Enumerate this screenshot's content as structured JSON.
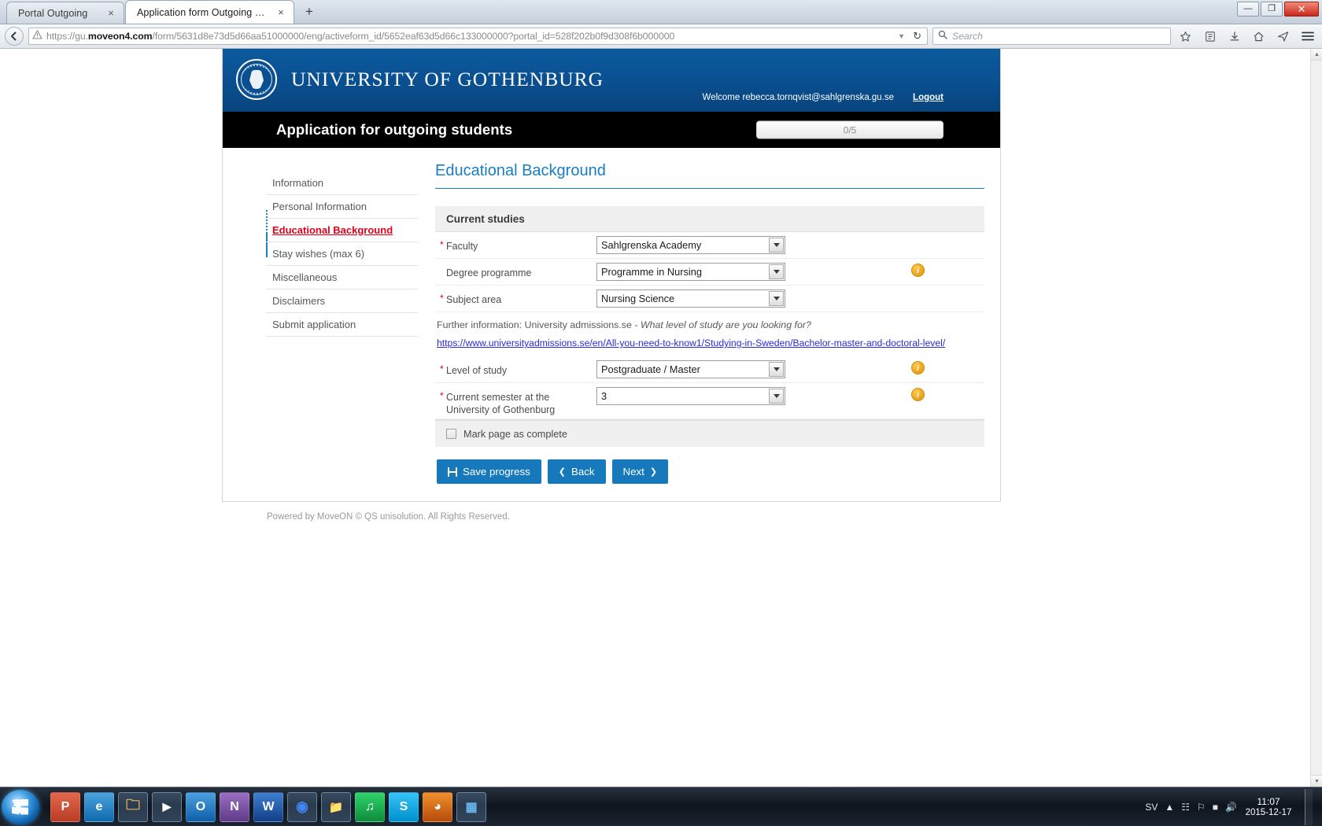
{
  "browser": {
    "tabs": [
      {
        "title": "Portal Outgoing",
        "active": false,
        "close": "×"
      },
      {
        "title": "Application form Outgoing Stu...",
        "active": true,
        "close": "×"
      }
    ],
    "newtab_label": "+",
    "window_controls": {
      "minimize": "—",
      "maximize": "❐",
      "close": "✕"
    },
    "url": {
      "scheme": "https://gu.",
      "domain": "moveon4.com",
      "path": "/form/5631d8e73d5d66aa51000000/eng/activeform_id/5652eaf63d5d66c133000000?portal_id=528f202b0f9d308f6b000000",
      "full": "https://gu.moveon4.com/form/5631d8e73d5d66aa51000000/eng/activeform_id/5652eaf63d5d66c133000000?portal_id=528f202b0f9d308f6b000000",
      "warning_icon": "warning-triangle-icon",
      "dropdown_icon": "chevron-down-icon",
      "reload_icon": "reload-icon"
    },
    "search": {
      "placeholder": "Search",
      "icon": "search-icon"
    },
    "toolbar_icons": [
      "bookmark-star-icon",
      "reading-list-icon",
      "downloads-icon",
      "home-icon",
      "share-icon",
      "menu-hamburger-icon"
    ],
    "back_icon": "back-arrow-icon"
  },
  "site": {
    "university_name": "UNIVERSITY OF GOTHENBURG",
    "logo_name": "university-of-gothenburg-seal",
    "welcome_text": "Welcome rebecca.tornqvist@sahlgrenska.gu.se",
    "logout_label": "Logout",
    "app_title": "Application for outgoing students",
    "progress_text": "0/5",
    "footer": "Powered by MoveON © QS unisolution. All Rights Reserved."
  },
  "sidebar": {
    "items": [
      {
        "label": "Information",
        "active": false
      },
      {
        "label": "Personal Information",
        "active": false
      },
      {
        "label": "Educational Background",
        "active": true
      },
      {
        "label": "Stay wishes (max 6)",
        "active": false
      },
      {
        "label": "Miscellaneous",
        "active": false
      },
      {
        "label": "Disclaimers",
        "active": false
      },
      {
        "label": "Submit application",
        "active": false
      }
    ]
  },
  "form": {
    "title": "Educational Background",
    "section_title": "Current studies",
    "rows": [
      {
        "label": "Faculty",
        "required": true,
        "value": "Sahlgrenska Academy",
        "info": false
      },
      {
        "label": "Degree programme",
        "required": false,
        "value": "Programme in Nursing",
        "info": true
      },
      {
        "label": "Subject area",
        "required": true,
        "value": "Nursing Science",
        "info": false
      }
    ],
    "help_prefix": "Further information: University admissions.se - ",
    "help_italic": "What level of study are you looking for?",
    "external_link": "https://www.universityadmissions.se/en/All-you-need-to-know1/Studying-in-Sweden/Bachelor-master-and-doctoral-level/",
    "rows2": [
      {
        "label": "Level of study",
        "required": true,
        "value": "Postgraduate / Master",
        "info": true
      },
      {
        "label": "Current semester at the University of Gothenburg",
        "required": true,
        "value": "3",
        "info": true
      }
    ],
    "mark_complete_label": "Mark page as complete",
    "info_badge_char": "i",
    "buttons": {
      "save": "Save progress",
      "back": "Back",
      "next": "Next",
      "back_arrow": "❮",
      "next_arrow": "❯"
    }
  },
  "taskbar": {
    "start_label": "start-orb",
    "apps": [
      {
        "name": "powerpoint",
        "glyph": "P",
        "color": "#c6472f"
      },
      {
        "name": "internet-explorer",
        "glyph": "e",
        "color": "#1b7fc4"
      },
      {
        "name": "windows-explorer",
        "glyph": "🗀",
        "color": "#e0a93a"
      },
      {
        "name": "media-player",
        "glyph": "▶",
        "color": "#2f6fb0"
      },
      {
        "name": "outlook",
        "glyph": "O",
        "color": "#1b6ec2"
      },
      {
        "name": "onenote",
        "glyph": "N",
        "color": "#7a4ea6"
      },
      {
        "name": "word",
        "glyph": "W",
        "color": "#1b4f9c"
      },
      {
        "name": "chrome",
        "glyph": "◉",
        "color": "#4285f4"
      },
      {
        "name": "folder",
        "glyph": "📁",
        "color": "#e6b24a"
      },
      {
        "name": "spotify",
        "glyph": "♫",
        "color": "#1db954"
      },
      {
        "name": "skype",
        "glyph": "S",
        "color": "#00aff0"
      },
      {
        "name": "firefox",
        "glyph": "◕",
        "color": "#e06a1a"
      },
      {
        "name": "blue-app",
        "glyph": "▦",
        "color": "#2f7fd0"
      }
    ],
    "tray": {
      "language": "SV",
      "icons": [
        "show-hidden-icons",
        "network-icon",
        "flag-icon",
        "battery-icon",
        "volume-icon"
      ],
      "time": "11:07",
      "date": "2015-12-17"
    }
  },
  "colors": {
    "gu_blue": "#0a5091",
    "accent_blue": "#1679bc",
    "active_red": "#e2001a",
    "link_blue": "#2b2bd6"
  }
}
